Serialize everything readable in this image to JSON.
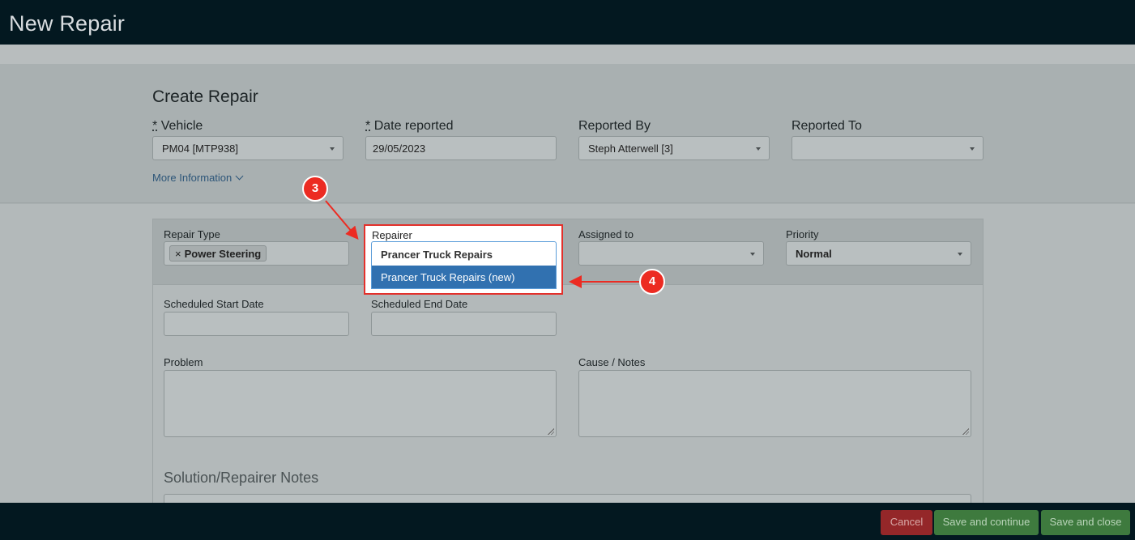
{
  "header": {
    "title": "New Repair"
  },
  "section": {
    "title": "Create Repair"
  },
  "fields": {
    "vehicle": {
      "req_mark": "*",
      "label": "Vehicle",
      "value": "PM04 [MTP938]"
    },
    "date_reported": {
      "req_mark": "*",
      "label": "Date reported",
      "value": "29/05/2023"
    },
    "reported_by": {
      "label": "Reported By",
      "value": "Steph Atterwell [3]"
    },
    "reported_to": {
      "label": "Reported To",
      "value": ""
    }
  },
  "more_info": {
    "label": "More Information"
  },
  "repair": {
    "repair_type": {
      "label": "Repair Type",
      "tag_remove": "×",
      "tag": "Power Steering"
    },
    "repairer": {
      "label": "Repairer",
      "search_value": "Prancer Truck Repairs",
      "option": "Prancer Truck Repairs (new)"
    },
    "assigned_to": {
      "label": "Assigned to",
      "value": ""
    },
    "priority": {
      "label": "Priority",
      "value": "Normal"
    },
    "scheduled_start": {
      "label": "Scheduled Start Date",
      "value": ""
    },
    "scheduled_end": {
      "label": "Scheduled End Date",
      "value": ""
    },
    "problem": {
      "label": "Problem"
    },
    "cause_notes": {
      "label": "Cause / Notes"
    },
    "solution_notes": {
      "label": "Solution/Repairer Notes"
    }
  },
  "annotations": {
    "step3": "3",
    "step4": "4",
    "color": "#ec2b22"
  },
  "footer": {
    "cancel": "Cancel",
    "save_continue": "Save and continue",
    "save_close": "Save and close"
  }
}
